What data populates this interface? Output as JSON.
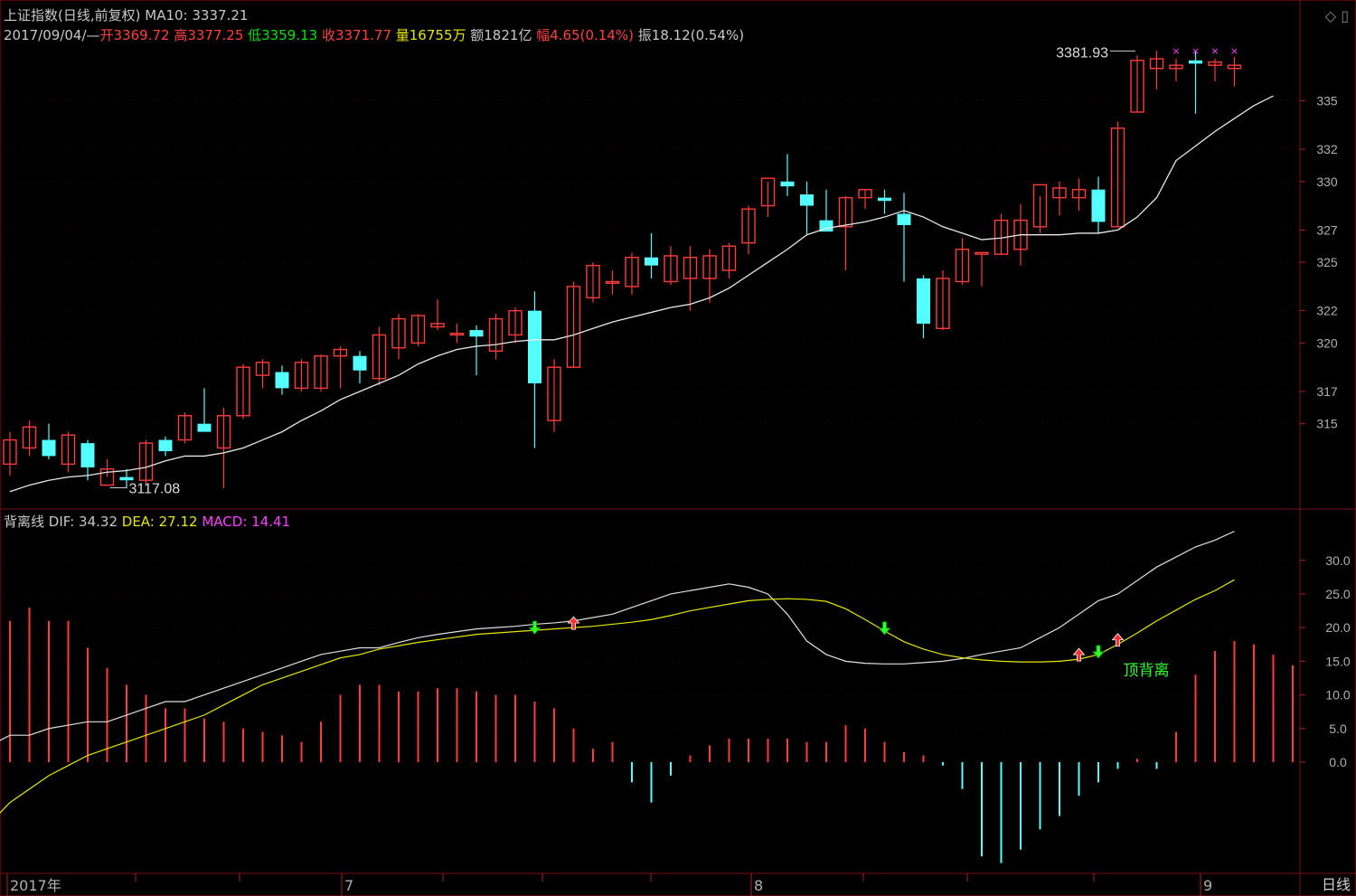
{
  "header": {
    "title": "上证指数(日线,前复权)",
    "ma_label": "MA10: 3337.21",
    "date": "2017/09/04/—",
    "open": "开3369.72",
    "high": "高3377.25",
    "low": "低3359.13",
    "close": "收3371.77",
    "volume": "量16755万",
    "amount": "额1821亿",
    "change": "幅4.65(0.14%)",
    "amplitude": "振18.12(0.54%)"
  },
  "indicator": {
    "name": "背离线",
    "dif": "DIF: 34.32",
    "dea": "DEA: 27.12",
    "macd": "MACD: 14.41",
    "divergence_label": "顶背离"
  },
  "annotations": {
    "max_label": "3381.93",
    "min_label": "3117.08"
  },
  "period_button": "日线",
  "icons": {
    "corner": [
      "diamond-icon",
      "window-icon"
    ]
  },
  "colors": {
    "up": "#ff3b3b",
    "down": "#54ffff",
    "ma": "#e8e8e8",
    "dea": "#e6e600",
    "macd_up": "#ff3b3b",
    "macd_down": "#54ffff",
    "background": "#000000"
  },
  "chart_data": [
    {
      "type": "candlestick",
      "title": "上证指数(日线,前复权)",
      "x_labels": [
        "2017年",
        "7",
        "8",
        "9"
      ],
      "y_ticks": [
        "315",
        "317",
        "320",
        "322",
        "325",
        "327",
        "330",
        "332",
        "335"
      ],
      "ylim": [
        3100,
        3390
      ],
      "candles": [
        {
          "o": 3125,
          "h": 3145,
          "l": 3118,
          "c": 3140
        },
        {
          "o": 3135,
          "h": 3152,
          "l": 3130,
          "c": 3148
        },
        {
          "o": 3140,
          "h": 3150,
          "l": 3128,
          "c": 3130
        },
        {
          "o": 3125,
          "h": 3145,
          "l": 3120,
          "c": 3143
        },
        {
          "o": 3138,
          "h": 3140,
          "l": 3115,
          "c": 3123
        },
        {
          "o": 3112,
          "h": 3128,
          "l": 3117,
          "c": 3122
        },
        {
          "o": 3117,
          "h": 3122,
          "l": 3110,
          "c": 3115
        },
        {
          "o": 3115,
          "h": 3140,
          "l": 3112,
          "c": 3138
        },
        {
          "o": 3140,
          "h": 3142,
          "l": 3130,
          "c": 3133
        },
        {
          "o": 3140,
          "h": 3157,
          "l": 3138,
          "c": 3155
        },
        {
          "o": 3150,
          "h": 3172,
          "l": 3145,
          "c": 3145
        },
        {
          "o": 3135,
          "h": 3160,
          "l": 3110,
          "c": 3155
        },
        {
          "o": 3155,
          "h": 3187,
          "l": 3153,
          "c": 3185
        },
        {
          "o": 3180,
          "h": 3190,
          "l": 3172,
          "c": 3188
        },
        {
          "o": 3182,
          "h": 3186,
          "l": 3168,
          "c": 3172
        },
        {
          "o": 3172,
          "h": 3190,
          "l": 3170,
          "c": 3188
        },
        {
          "o": 3172,
          "h": 3193,
          "l": 3170,
          "c": 3192
        },
        {
          "o": 3192,
          "h": 3198,
          "l": 3172,
          "c": 3196
        },
        {
          "o": 3192,
          "h": 3195,
          "l": 3175,
          "c": 3183
        },
        {
          "o": 3178,
          "h": 3210,
          "l": 3174,
          "c": 3205
        },
        {
          "o": 3197,
          "h": 3218,
          "l": 3190,
          "c": 3215
        },
        {
          "o": 3200,
          "h": 3218,
          "l": 3198,
          "c": 3217
        },
        {
          "o": 3210,
          "h": 3227,
          "l": 3208,
          "c": 3212
        },
        {
          "o": 3205,
          "h": 3212,
          "l": 3200,
          "c": 3206
        },
        {
          "o": 3208,
          "h": 3211,
          "l": 3180,
          "c": 3204
        },
        {
          "o": 3195,
          "h": 3218,
          "l": 3190,
          "c": 3215
        },
        {
          "o": 3205,
          "h": 3222,
          "l": 3200,
          "c": 3220
        },
        {
          "o": 3220,
          "h": 3232,
          "l": 3135,
          "c": 3175
        },
        {
          "o": 3152,
          "h": 3190,
          "l": 3145,
          "c": 3185
        },
        {
          "o": 3185,
          "h": 3238,
          "l": 3185,
          "c": 3235
        },
        {
          "o": 3228,
          "h": 3250,
          "l": 3225,
          "c": 3248
        },
        {
          "o": 3237,
          "h": 3245,
          "l": 3230,
          "c": 3238
        },
        {
          "o": 3235,
          "h": 3256,
          "l": 3230,
          "c": 3253
        },
        {
          "o": 3253,
          "h": 3268,
          "l": 3240,
          "c": 3248
        },
        {
          "o": 3238,
          "h": 3260,
          "l": 3236,
          "c": 3254
        },
        {
          "o": 3240,
          "h": 3260,
          "l": 3220,
          "c": 3253
        },
        {
          "o": 3240,
          "h": 3258,
          "l": 3225,
          "c": 3254
        },
        {
          "o": 3245,
          "h": 3262,
          "l": 3240,
          "c": 3260
        },
        {
          "o": 3262,
          "h": 3285,
          "l": 3255,
          "c": 3283
        },
        {
          "o": 3285,
          "h": 3300,
          "l": 3278,
          "c": 3302
        },
        {
          "o": 3300,
          "h": 3317,
          "l": 3291,
          "c": 3297
        },
        {
          "o": 3292,
          "h": 3300,
          "l": 3267,
          "c": 3285
        },
        {
          "o": 3276,
          "h": 3295,
          "l": 3270,
          "c": 3269
        },
        {
          "o": 3272,
          "h": 3291,
          "l": 3245,
          "c": 3290
        },
        {
          "o": 3290,
          "h": 3295,
          "l": 3283,
          "c": 3295
        },
        {
          "o": 3290,
          "h": 3295,
          "l": 3280,
          "c": 3288
        },
        {
          "o": 3280,
          "h": 3293,
          "l": 3238,
          "c": 3273
        },
        {
          "o": 3240,
          "h": 3242,
          "l": 3203,
          "c": 3212
        },
        {
          "o": 3209,
          "h": 3245,
          "l": 3208,
          "c": 3240
        },
        {
          "o": 3238,
          "h": 3265,
          "l": 3236,
          "c": 3258
        },
        {
          "o": 3255,
          "h": 3255,
          "l": 3235,
          "c": 3256
        },
        {
          "o": 3255,
          "h": 3280,
          "l": 3255,
          "c": 3276
        },
        {
          "o": 3258,
          "h": 3286,
          "l": 3248,
          "c": 3276
        },
        {
          "o": 3272,
          "h": 3291,
          "l": 3268,
          "c": 3298
        },
        {
          "o": 3290,
          "h": 3300,
          "l": 3279,
          "c": 3296
        },
        {
          "o": 3290,
          "h": 3302,
          "l": 3282,
          "c": 3295
        },
        {
          "o": 3295,
          "h": 3303,
          "l": 3268,
          "c": 3275
        },
        {
          "o": 3272,
          "h": 3337,
          "l": 3272,
          "c": 3333
        },
        {
          "o": 3343,
          "h": 3378,
          "l": 3343,
          "c": 3375
        },
        {
          "o": 3370,
          "h": 3381,
          "l": 3357,
          "c": 3376
        },
        {
          "o": 3370,
          "h": 3376,
          "l": 3362,
          "c": 3372
        },
        {
          "o": 3375,
          "h": 3381,
          "l": 3342,
          "c": 3373
        },
        {
          "o": 3372,
          "h": 3376,
          "l": 3362,
          "c": 3374
        },
        {
          "o": 3370,
          "h": 3377,
          "l": 3359,
          "c": 3372
        }
      ],
      "ma10": [
        3108,
        3112,
        3115,
        3117,
        3118,
        3120,
        3121,
        3123,
        3127,
        3130,
        3130,
        3132,
        3135,
        3140,
        3145,
        3152,
        3158,
        3165,
        3170,
        3175,
        3180,
        3187,
        3192,
        3196,
        3198,
        3199,
        3201,
        3202,
        3202,
        3205,
        3209,
        3213,
        3216,
        3219,
        3222,
        3224,
        3228,
        3234,
        3242,
        3250,
        3258,
        3267,
        3271,
        3273,
        3275,
        3278,
        3282,
        3278,
        3272,
        3268,
        3264,
        3265,
        3267,
        3267,
        3267,
        3268,
        3268,
        3270,
        3278,
        3290,
        3313,
        3322,
        3331,
        3339,
        3347,
        3353
      ],
      "max_annotation": {
        "label": "3381.93",
        "index": 58
      },
      "min_annotation": {
        "label": "3117.08",
        "index": 5
      }
    },
    {
      "type": "macd",
      "title": "背离线",
      "y_ticks": [
        "0.0",
        "5.0",
        "10.0",
        "15.0",
        "20.0",
        "25.0",
        "30.0"
      ],
      "ylim": [
        -16,
        34
      ],
      "dif": [
        -5,
        0,
        1,
        3,
        3,
        2.5,
        4,
        4,
        5,
        5.5,
        6,
        6,
        7,
        8,
        9,
        9,
        10,
        11,
        12,
        13,
        14,
        15,
        16,
        16.5,
        17,
        17,
        17.8,
        18.5,
        19,
        19.4,
        19.8,
        20,
        20.2,
        20.5,
        20.7,
        21,
        21.5,
        22,
        23,
        24,
        25,
        25.5,
        26,
        26.5,
        26,
        25,
        22,
        18,
        16,
        15,
        14.7,
        14.6,
        14.6,
        14.8,
        15,
        15.4,
        16,
        16.5,
        17,
        18.5,
        20,
        22,
        24,
        25,
        27,
        29,
        30.5,
        32,
        33,
        34.32
      ],
      "dea": [
        -15,
        -12,
        -9,
        -6,
        -4,
        -2,
        -0.5,
        1,
        2,
        3,
        4,
        5,
        6,
        7,
        8.5,
        10,
        11.5,
        12.5,
        13.5,
        14.5,
        15.5,
        16,
        16.8,
        17.3,
        17.8,
        18.2,
        18.6,
        19,
        19.2,
        19.4,
        19.6,
        19.8,
        20,
        20.2,
        20.5,
        20.8,
        21.2,
        21.8,
        22.5,
        23,
        23.5,
        24,
        24.2,
        24.3,
        24.2,
        23.9,
        22.8,
        21.2,
        19.5,
        17.9,
        16.8,
        16,
        15.5,
        15.2,
        15,
        14.9,
        14.9,
        15,
        15.3,
        16,
        17.5,
        19.2,
        21,
        22.6,
        24.2,
        25.5,
        27.12
      ],
      "macd": [
        21,
        23,
        21,
        21,
        17,
        14,
        11.5,
        10,
        8,
        8,
        6.5,
        6,
        5,
        4.5,
        4,
        3,
        6,
        10,
        11.5,
        11.5,
        10.5,
        10.5,
        11,
        11,
        10.5,
        10,
        10,
        9,
        8,
        5,
        2,
        3,
        -3,
        -6,
        -2,
        1,
        2.5,
        3.5,
        3.5,
        3.5,
        3.5,
        3,
        3,
        5.5,
        5,
        3,
        1.5,
        1,
        -0.5,
        -4,
        -14,
        -15,
        -13,
        -10,
        -8,
        -5,
        -3,
        -1,
        0.5,
        -1,
        4.5,
        13,
        16.5,
        18,
        17.5,
        16,
        14.41
      ],
      "signals": [
        {
          "index": 27,
          "type": "sell"
        },
        {
          "index": 29,
          "type": "buy"
        },
        {
          "index": 45,
          "type": "sell"
        },
        {
          "index": 55,
          "type": "buy"
        },
        {
          "index": 56,
          "type": "sell"
        },
        {
          "index": 57,
          "type": "buy"
        }
      ]
    }
  ]
}
